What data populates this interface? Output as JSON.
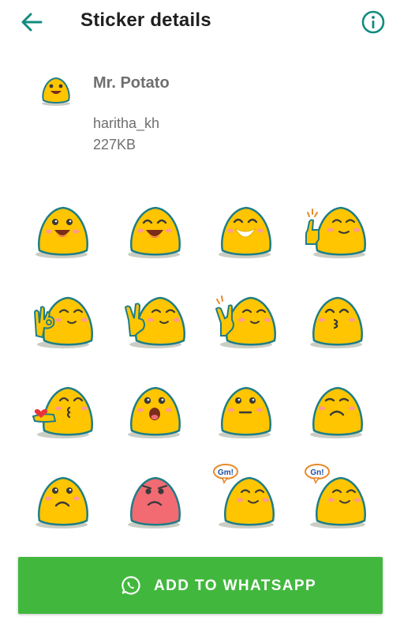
{
  "header": {
    "title": "Sticker details",
    "back_icon": "arrow-back-icon",
    "info_icon": "info-icon"
  },
  "pack": {
    "name": "Mr. Potato",
    "author": "haritha_kh",
    "size": "227KB"
  },
  "stickers": [
    {
      "expression": "happy-open"
    },
    {
      "expression": "grin-closed"
    },
    {
      "expression": "big-smile"
    },
    {
      "expression": "thumbs-up"
    },
    {
      "expression": "ok-hand"
    },
    {
      "expression": "peace-sign"
    },
    {
      "expression": "rock-sign"
    },
    {
      "expression": "kiss"
    },
    {
      "expression": "heart-kiss"
    },
    {
      "expression": "shocked"
    },
    {
      "expression": "neutral"
    },
    {
      "expression": "sad-closed"
    },
    {
      "expression": "sad-open"
    },
    {
      "expression": "angry-red"
    },
    {
      "expression": "good-morning",
      "bubble": "Gm!"
    },
    {
      "expression": "good-night",
      "bubble": "Gn!"
    }
  ],
  "action": {
    "label": "ADD TO WHATSAPP",
    "icon": "whatsapp-icon"
  },
  "colors": {
    "accent": "#128c7e",
    "button": "#41b83d",
    "potato": "#ffc500",
    "potato_outline": "#1e7d86",
    "angry": "#f26b72",
    "blush": "#ff9a8f"
  }
}
